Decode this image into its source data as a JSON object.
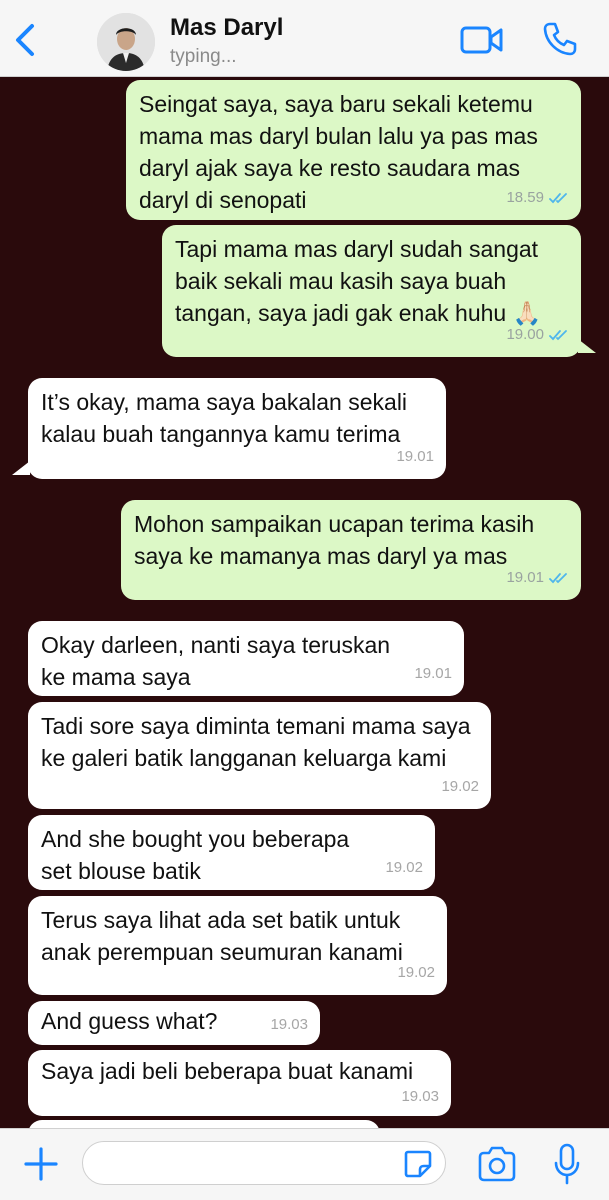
{
  "header": {
    "contact_name": "Mas Daryl",
    "status": "typing..."
  },
  "messages": [
    {
      "direction": "outgoing",
      "text": "Seingat saya, saya baru sekali ketemu mama mas daryl bulan lalu ya pas mas daryl ajak saya ke resto saudara mas daryl di senopati",
      "time": "18.59",
      "read": true
    },
    {
      "direction": "outgoing",
      "text": "Tapi mama mas daryl sudah sangat baik sekali mau kasih saya buah tangan, saya jadi gak enak huhu 🙏🏻",
      "time": "19.00",
      "read": true
    },
    {
      "direction": "incoming",
      "text": "It’s okay, mama saya bakalan sekali kalau buah tangannya kamu terima",
      "time": "19.01"
    },
    {
      "direction": "outgoing",
      "text": "Mohon sampaikan ucapan terima kasih saya ke mamanya mas daryl ya mas",
      "time": "19.01",
      "read": true
    },
    {
      "direction": "incoming",
      "text": "Okay darleen, nanti saya teruskan ke mama saya",
      "time": "19.01"
    },
    {
      "direction": "incoming",
      "text": "Tadi sore saya diminta temani mama saya ke galeri batik langganan keluarga kami",
      "time": "19.02"
    },
    {
      "direction": "incoming",
      "text": "And she bought you beberapa set blouse batik",
      "time": "19.02"
    },
    {
      "direction": "incoming",
      "text": "Terus saya lihat ada set batik untuk anak perempuan seumuran kanami",
      "time": "19.02"
    },
    {
      "direction": "incoming",
      "text": "And guess what?",
      "time": "19.03"
    },
    {
      "direction": "incoming",
      "text": "Saya jadi beli beberapa buat kanami",
      "time": "19.03"
    }
  ],
  "composer": {
    "placeholder": "",
    "value": ""
  },
  "icons": {
    "back": "chevron-left-icon",
    "video": "video-camera-icon",
    "call": "phone-icon",
    "plus": "plus-icon",
    "sticker": "sticker-icon",
    "camera": "camera-icon",
    "mic": "microphone-icon"
  },
  "colors": {
    "accent": "#1a85ff",
    "outgoing_bubble": "#dcf8c6",
    "incoming_bubble": "#ffffff",
    "chat_background": "#2a0a0c",
    "read_ticks": "#4fb6ec"
  }
}
